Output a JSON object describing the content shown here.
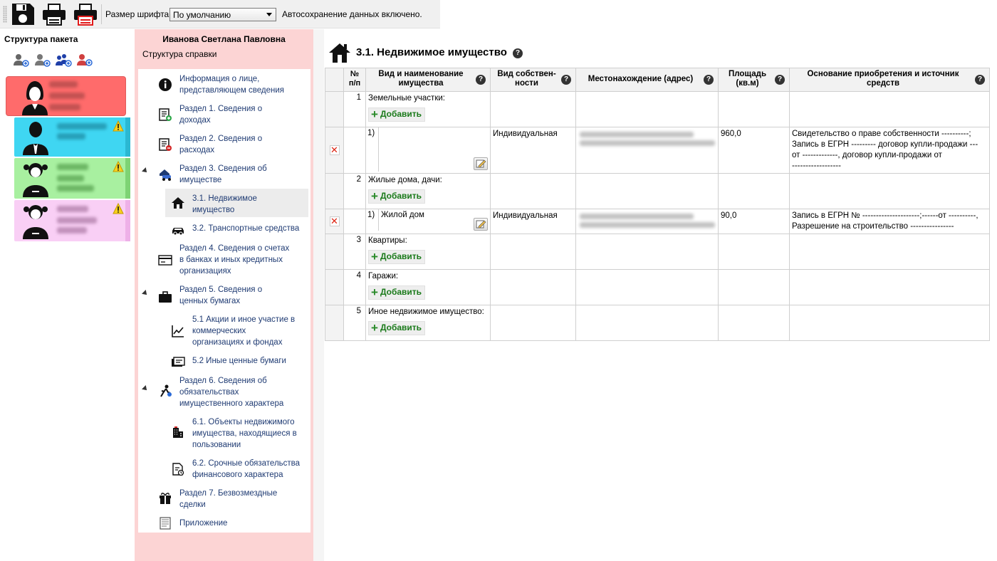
{
  "toolbar": {
    "font_size_label": "Размер шрифта:",
    "font_size_value": "По умолчанию",
    "autosave_text": "Автосохранение данных включено."
  },
  "package": {
    "title": "Структура пакета",
    "cards": [
      {
        "color": "#ff6b6b",
        "warning": false
      },
      {
        "color": "#3fd6f2",
        "warning": true
      },
      {
        "color": "#a8f0a0",
        "warning": true
      },
      {
        "color": "#f9cff5",
        "warning": true
      }
    ]
  },
  "middle": {
    "person_name": "Иванова Светлана Павловна",
    "subtitle": "Структура справки",
    "tree": [
      {
        "label_lines": [
          "Информация о лице,",
          "представляющем сведения"
        ],
        "icon": "info-icon"
      },
      {
        "label_lines": [
          "Раздел 1. Сведения о",
          "доходах"
        ],
        "icon": "income-icon"
      },
      {
        "label_lines": [
          "Раздел 2. Сведения о",
          "расходах"
        ],
        "icon": "expense-icon"
      },
      {
        "label_lines": [
          "Раздел 3. Сведения об",
          "имуществе"
        ],
        "icon": "property-icon"
      },
      {
        "label_lines": [
          "3.1. Недвижимое",
          "имущество"
        ],
        "icon": "house-icon"
      },
      {
        "label_lines": [
          "3.2. Транспортные средства"
        ],
        "icon": "car-icon"
      },
      {
        "label_lines": [
          "Раздел 4. Сведения о счетах",
          "в банках и иных кредитных",
          "организациях"
        ],
        "icon": "bank-card-icon"
      },
      {
        "label_lines": [
          "Раздел 5. Сведения о",
          "ценных бумагах"
        ],
        "icon": "briefcase-icon"
      },
      {
        "label_lines": [
          "5.1 Акции и иное участие в",
          "коммерческих",
          "организациях и фондах"
        ],
        "icon": "stock-chart-icon"
      },
      {
        "label_lines": [
          "5.2 Иные ценные бумаги"
        ],
        "icon": "securities-icon"
      },
      {
        "label_lines": [
          "Раздел 6. Сведения об",
          "обязательствах",
          "имущественного характера"
        ],
        "icon": "obligation-icon"
      },
      {
        "label_lines": [
          "6.1. Объекты недвижимого",
          "имущества, находящиеся в",
          "пользовании"
        ],
        "icon": "building-icon"
      },
      {
        "label_lines": [
          "6.2. Срочные обязательства",
          "финансового характера"
        ],
        "icon": "contract-icon"
      },
      {
        "label_lines": [
          "Раздел 7. Безвозмездные",
          "сделки"
        ],
        "icon": "gift-icon"
      },
      {
        "label_lines": [
          "Приложение"
        ],
        "icon": "attachment-icon"
      }
    ]
  },
  "content": {
    "section_title": "3.1. Недвижимое имущество",
    "headers": {
      "num": [
        "№",
        "п/п"
      ],
      "name": [
        "Вид и наименование",
        "имущества"
      ],
      "ownership": [
        "Вид собствен-",
        "ности"
      ],
      "location": "Местонахождение (адрес)",
      "area": [
        "Площадь",
        "(кв.м)"
      ],
      "basis": [
        "Основание приобретения и источник",
        "средств"
      ]
    },
    "add_label": "Добавить",
    "categories": [
      {
        "num": "1",
        "title": "Земельные участки:"
      },
      {
        "num": "2",
        "title": "Жилые дома, дачи:"
      },
      {
        "num": "3",
        "title": "Квартиры:"
      },
      {
        "num": "4",
        "title": "Гаражи:"
      },
      {
        "num": "5",
        "title": "Иное недвижимое имущество:"
      }
    ],
    "items": [
      {
        "sub": "1)",
        "name": "",
        "ownership": "Индивидуальная",
        "area": "960,0",
        "basis_lines": [
          "Свидетельство о праве собственности ----------;",
          "Запись в ЕГРН --------- договор купли-продажи ---",
          "от -------------, договор купли-продажи от",
          "------------------"
        ]
      },
      {
        "sub": "1)",
        "name": "Жилой дом",
        "ownership": "Индивидуальная",
        "area": "90,0",
        "basis_lines": [
          "Запись в ЕГРН №  ---------------------;------от ----------,",
          "Разрешение на строительство ----------------"
        ]
      }
    ]
  }
}
